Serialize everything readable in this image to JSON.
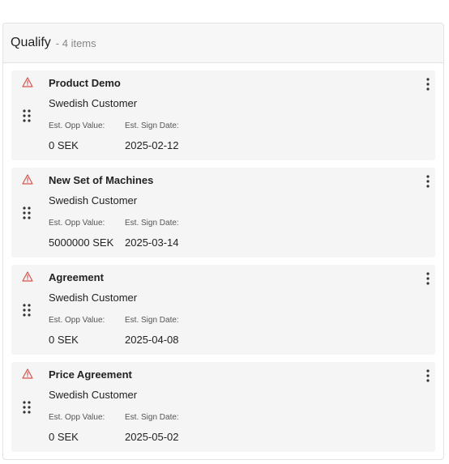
{
  "column": {
    "title": "Qualify",
    "count_label": "- 4 items"
  },
  "colors": {
    "warning": "#d9534f",
    "card_bg": "#f5f5f5",
    "header_bg": "#f7f7f7"
  },
  "icons": {
    "status": "warning-triangle-icon",
    "drag": "drag-handle-icon",
    "menu": "kebab-menu-icon"
  },
  "labels": {
    "opp_value": "Est. Opp Value:",
    "sign_date": "Est. Sign Date:"
  },
  "cards": [
    {
      "title": "Product Demo",
      "customer": "Swedish Customer",
      "opp_value": "0 SEK",
      "sign_date": "2025-02-12"
    },
    {
      "title": "New Set of Machines",
      "customer": "Swedish Customer",
      "opp_value": "5000000 SEK",
      "sign_date": "2025-03-14"
    },
    {
      "title": "Agreement",
      "customer": "Swedish Customer",
      "opp_value": "0 SEK",
      "sign_date": "2025-04-08"
    },
    {
      "title": "Price Agreement",
      "customer": "Swedish Customer",
      "opp_value": "0 SEK",
      "sign_date": "2025-05-02"
    }
  ]
}
